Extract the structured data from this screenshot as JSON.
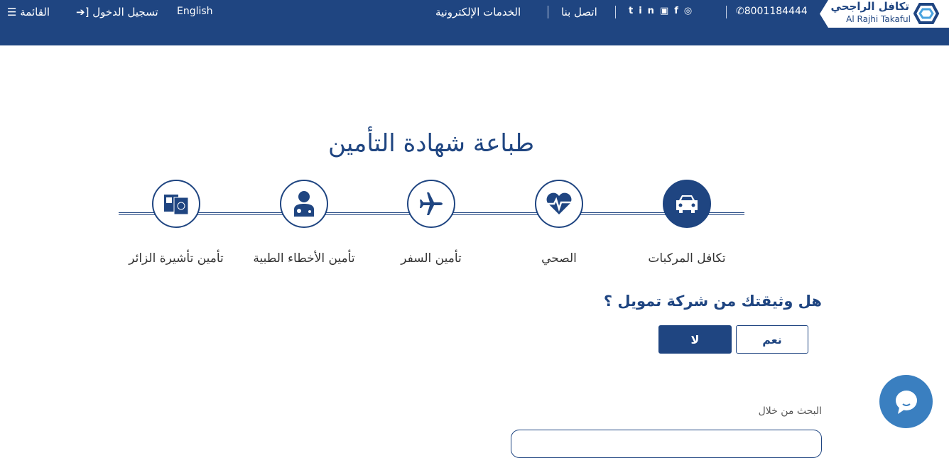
{
  "header": {
    "menu": "القائمة",
    "login": "تسجيل الدخول",
    "language": "English",
    "eservices": "الخدمات الإلكترونية",
    "contact": "اتصل بنا",
    "phone": "8001184444",
    "social": [
      "instagram-icon",
      "facebook-icon",
      "youtube-icon",
      "linkedin-icon",
      "twitter-icon"
    ],
    "logo_ar": "تكافل الراجحي",
    "logo_en": "Al Rajhi Takaful"
  },
  "page": {
    "title": "طباعة شهادة التأمين"
  },
  "categories": [
    {
      "label": "تكافل المركبات",
      "icon": "car-icon",
      "selected": true
    },
    {
      "label": "الصحي",
      "icon": "heart-pulse-icon"
    },
    {
      "label": "تأمين السفر",
      "icon": "plane-icon"
    },
    {
      "label": "تأمين الأخطاء الطبية",
      "icon": "doctor-icon"
    },
    {
      "label": "تأمين تأشيرة الزائر",
      "icon": "passport-icon"
    }
  ],
  "question": {
    "text": "هل وثيقتك من شركة تمويل ؟",
    "yes": "نعم",
    "no": "لا",
    "selected": "لا"
  },
  "search": {
    "label": "البحث من خلال",
    "value": ""
  },
  "colors": {
    "brand": "#1f4581",
    "chat": "#3a7fc0"
  }
}
